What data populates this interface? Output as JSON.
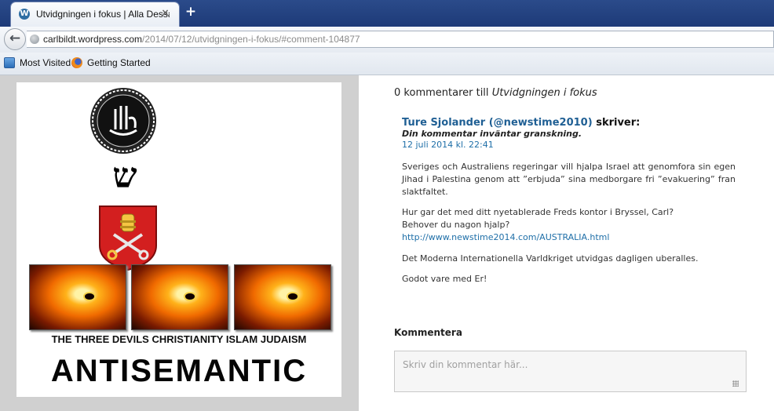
{
  "browser": {
    "tab": {
      "title": "Utvidgningen i fokus | Alla Dessa ...",
      "favicon": "wordpress-icon"
    },
    "url": {
      "domain": "carlbildt.wordpress.com",
      "path": "/2014/07/12/utvidgningen-i-fokus/#comment-104877"
    },
    "bookmarks": [
      {
        "label": "Most Visited",
        "icon": "most-visited-icon"
      },
      {
        "label": "Getting Started",
        "icon": "firefox-icon"
      }
    ]
  },
  "artwork": {
    "caption": "THE THREE DEVILS CHRISTIANITY ISLAM JUDAISM",
    "headline": "ANTISEMANTIC",
    "shin_glyph": "ש"
  },
  "comments": {
    "count": "0",
    "heading_text": "kommentarer till",
    "post_title": "Utvidgningen i fokus",
    "items": [
      {
        "author": "Ture Sjolander (@newstime2010)",
        "says": "skriver:",
        "moderation": "Din kommentar inväntar granskning.",
        "date": "12 juli 2014 kl. 22:41",
        "para1": "Sveriges och Australiens regeringar vill hjalpa Israel att genomfora sin egen Jihad i Palestina genom att ”erbjuda” sina medborgare fri ”evakuering” fran slaktfaltet.",
        "para2_line1": "Hur gar det med ditt nyetablerade Freds kontor i Bryssel, Carl?",
        "para2_line2": "Behover du nagon hjalp?",
        "link": "http://www.newstime2014.com/AUSTRALIA.html",
        "para3": "Det Moderna Internationella Varldkriget utvidgas dagligen uberalles.",
        "para4": "Godot vare med Er!"
      }
    ]
  },
  "reply": {
    "heading": "Kommentera",
    "placeholder": "Skriv din kommentar här..."
  }
}
